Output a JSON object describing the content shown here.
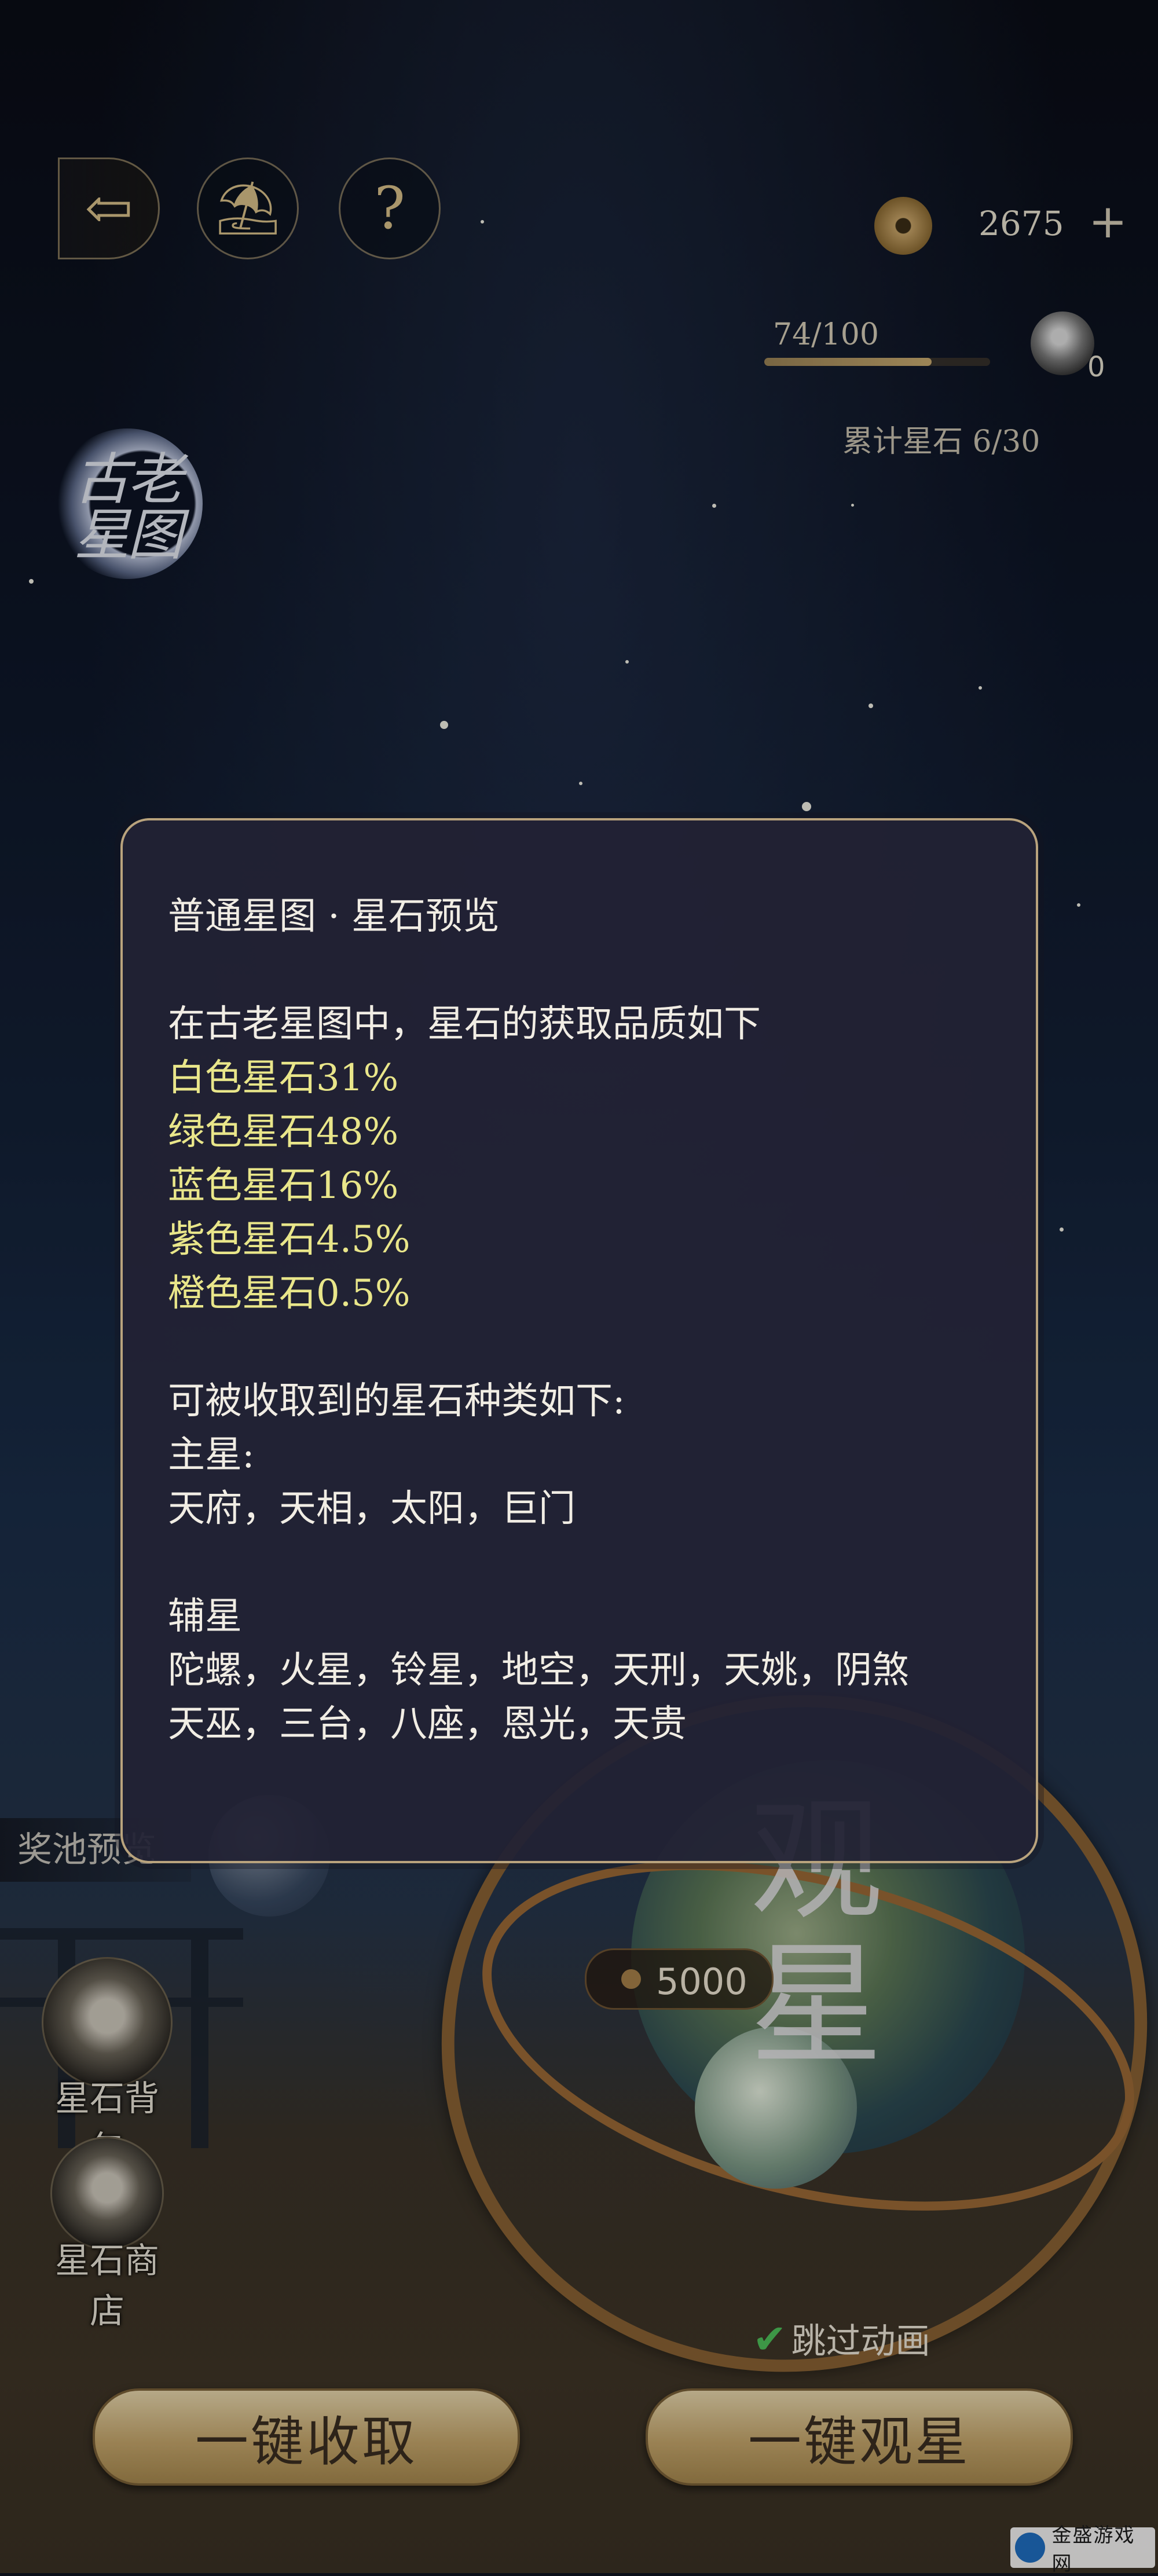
{
  "topbar": {
    "back_icon": "back-arrow-icon",
    "home_icon": "pagoda-icon",
    "help_label": "?",
    "coins": "2675",
    "coins_plus": "+"
  },
  "progress": {
    "text": "74/100",
    "fraction": 0.74,
    "bag_count": "0"
  },
  "accumulated": "累计星石 6/30",
  "map_logo": "古老星图",
  "dialog": {
    "title": "普通星图 · 星石预览",
    "intro": "在古老星图中，星石的获取品质如下",
    "qualities": [
      "白色星石31%",
      "绿色星石48%",
      "蓝色星石16%",
      "紫色星石4.5%",
      "橙色星石0.5%"
    ],
    "types_heading": "可被收取到的星石种类如下:",
    "main_heading": "主星:",
    "main_stars": "天府，天相，太阳，巨门",
    "aux_heading": "辅星",
    "aux_stars_1": "陀螺，火星，铃星，地空，天刑，天姚，阴煞",
    "aux_stars_2": "天巫，三台，八座，恩光，天贵"
  },
  "side": {
    "pool_preview": "奖池预览",
    "bag_label": "星石背包",
    "shop_label": "星石商店"
  },
  "globe": {
    "label": "观星",
    "cost": "5000"
  },
  "skip_animation": "跳过动画",
  "buttons": {
    "collect": "一键收取",
    "observe": "一键观星"
  },
  "watermark": "金盛游戏网",
  "colors": {
    "quality_text": "#e9e68a",
    "gold": "#c6a76c",
    "dialog_border": "#b9a37d"
  }
}
